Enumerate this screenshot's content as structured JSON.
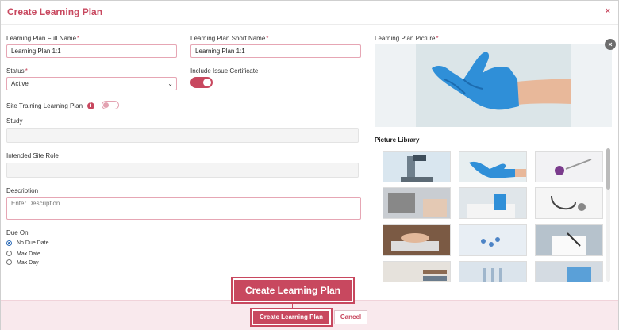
{
  "dialog": {
    "title": "Create Learning Plan",
    "close_label": "×"
  },
  "form": {
    "full_name": {
      "label": "Learning Plan Full Name",
      "required_mark": "*",
      "value": "Learning Plan 1:1"
    },
    "short_name": {
      "label": "Learning Plan Short Name",
      "required_mark": "*",
      "value": "Learning Plan 1:1"
    },
    "status": {
      "label": "Status",
      "required_mark": "*",
      "value": "Active"
    },
    "issue_certificate": {
      "label": "Include Issue Certificate",
      "on": true
    },
    "site_training": {
      "label": "Site Training Learning Plan",
      "info": "i",
      "on": false
    },
    "study": {
      "label": "Study",
      "value": ""
    },
    "intended_role": {
      "label": "Intended Site Role",
      "value": ""
    },
    "description": {
      "label": "Description",
      "placeholder": "Enter Description"
    },
    "due_on": {
      "label": "Due On",
      "options": [
        {
          "label": "No Due Date",
          "selected": true
        },
        {
          "label": "Max Date",
          "selected": false
        },
        {
          "label": "Max Day",
          "selected": false
        }
      ]
    }
  },
  "picture": {
    "label": "Learning Plan Picture",
    "required_mark": "*",
    "remove_label": "×",
    "current_icon": "blue-glove-hand-image"
  },
  "library": {
    "title": "Picture Library",
    "thumbnails": [
      "microscope-image",
      "blue-glove-image",
      "syringe-vial-image",
      "laptop-typing-image",
      "lab-pipette-image",
      "stethoscope-image",
      "keyboard-hands-image",
      "pills-image",
      "writing-paper-image",
      "books-image",
      "test-tubes-image",
      "laptop-desk-image"
    ]
  },
  "actions": {
    "create_label": "Create Learning Plan",
    "cancel_label": "Cancel"
  },
  "colors": {
    "accent": "#c8485f",
    "glove": "#2f8fd8",
    "footer_bg": "#f9e9ed"
  }
}
